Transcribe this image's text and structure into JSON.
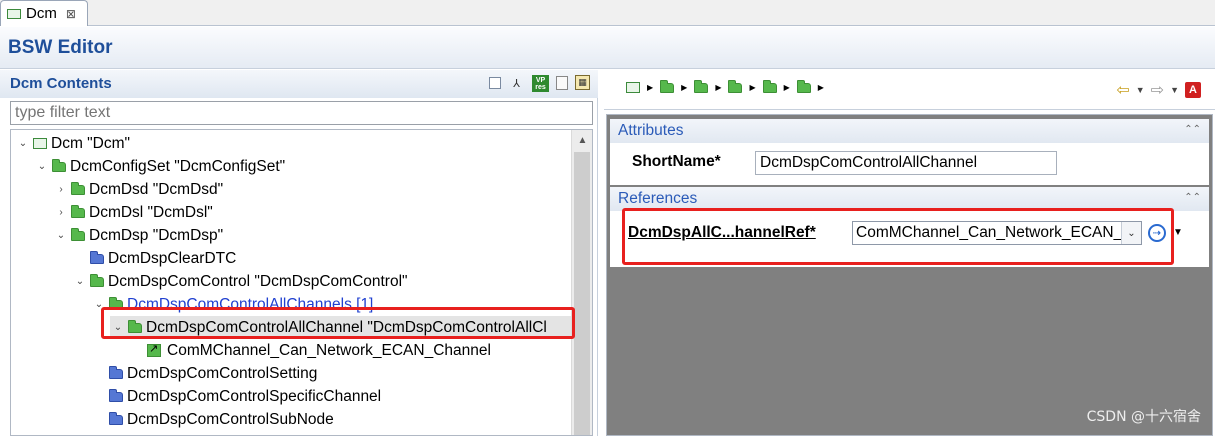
{
  "editor_tab": {
    "label": "Dcm",
    "close_glyph": "⊠"
  },
  "editor_title": "BSW Editor",
  "left_panel": {
    "title": "Dcm Contents",
    "tool_icons": [
      "collapse-all-icon",
      "hierarchy-icon",
      "vp-res-icon",
      "document-icon",
      "table-layout-icon"
    ],
    "filter_placeholder": "type filter text",
    "tree": [
      {
        "label": "Dcm \"Dcm\"",
        "icon": "module-icon",
        "expanded": true
      },
      {
        "label": "DcmConfigSet \"DcmConfigSet\"",
        "icon": "green-folder-icon",
        "expanded": true
      },
      {
        "label": "DcmDsd \"DcmDsd\"",
        "icon": "green-folder-icon",
        "expanded": false
      },
      {
        "label": "DcmDsl \"DcmDsl\"",
        "icon": "green-folder-icon",
        "expanded": false
      },
      {
        "label": "DcmDsp \"DcmDsp\"",
        "icon": "green-folder-icon",
        "expanded": true
      },
      {
        "label": "DcmDspClearDTC",
        "icon": "blue-folder-icon"
      },
      {
        "label": "DcmDspComControl \"DcmDspComControl\"",
        "icon": "green-folder-icon",
        "expanded": true
      },
      {
        "label": "DcmDspComControlAllChannels [1]",
        "icon": "green-folder-icon",
        "expanded": true,
        "style": "link"
      },
      {
        "label": "DcmDspComControlAllChannel \"DcmDspComControlAllCl",
        "icon": "green-folder-icon",
        "expanded": true,
        "selected": true
      },
      {
        "label": "ComMChannel_Can_Network_ECAN_Channel",
        "icon": "reference-icon"
      },
      {
        "label": "DcmDspComControlSetting",
        "icon": "blue-folder-icon"
      },
      {
        "label": "DcmDspComControlSpecificChannel",
        "icon": "blue-folder-icon"
      },
      {
        "label": "DcmDspComControlSubNode",
        "icon": "blue-folder-icon"
      }
    ]
  },
  "right_panel": {
    "breadcrumb_icons": [
      "module-icon",
      "green-folder-icon",
      "green-folder-icon",
      "green-folder-icon",
      "green-folder-icon",
      "green-folder-icon"
    ],
    "attributes": {
      "header": "Attributes",
      "shortname_label": "ShortName*",
      "shortname_value": "DcmDspComControlAllChannel"
    },
    "references": {
      "header": "References",
      "ref_label": "DcmDspAllC...hannelRef*",
      "ref_value": "ComMChannel_Can_Network_ECAN_"
    }
  },
  "watermark": "CSDN @十六宿舍",
  "colors": {
    "highlight_box": "#e8201e",
    "title_blue": "#1f4f9a",
    "link_blue": "#2040d0",
    "form_gray": "#808080"
  }
}
